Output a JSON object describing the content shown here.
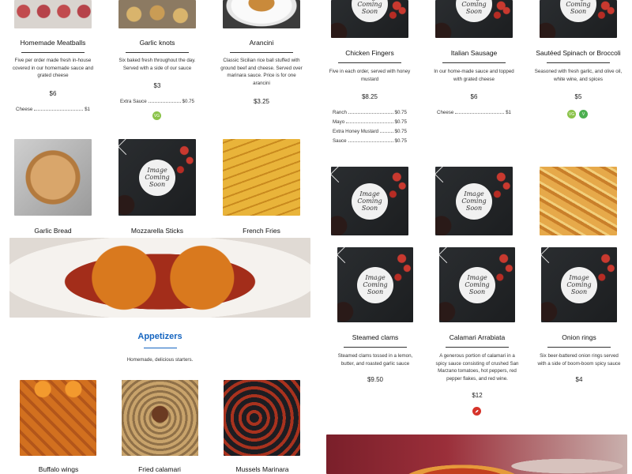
{
  "items": {
    "meatballs": {
      "title": "Homemade Meatballs",
      "desc": "Five per order made fresh in-house covered in our homemade sauce and grated cheese",
      "price": "$6",
      "addons": [
        {
          "name": "Cheese",
          "price": "$1"
        }
      ]
    },
    "garlic_knots": {
      "title": "Garlic knots",
      "desc": "Six baked fresh throughout the day. Served with a side of our sauce",
      "price": "$3",
      "addons": [
        {
          "name": "Extra Sauce",
          "price": "$0.75"
        }
      ],
      "badge": "VG"
    },
    "arancini": {
      "title": "Arancini",
      "desc": "Classic Sicilian rice ball stuffed with ground beef and cheese. Served over marinara sauce. Price is for one arancini",
      "price": "$3.25"
    },
    "chicken_fingers": {
      "title": "Chicken Fingers",
      "desc": "Five in each order, served with honey mustard",
      "price": "$8.25",
      "addons": [
        {
          "name": "Ranch",
          "price": "$0.75"
        },
        {
          "name": "Mayo",
          "price": "$0.75"
        },
        {
          "name": "Extra Honey Mustard",
          "price": "$0.75"
        },
        {
          "name": "Sauce",
          "price": "$0.75"
        }
      ]
    },
    "italian_sausage": {
      "title": "Italian Sausage",
      "desc": "In our home-made sauce and topped with grated cheese",
      "price": "$6",
      "addons": [
        {
          "name": "Cheese",
          "price": "$1"
        }
      ]
    },
    "spinach": {
      "title": "Sautéed Spinach or Broccoli",
      "desc": "Seasoned with fresh garlic, and olive oil, white wine, and spices",
      "price": "$5",
      "badges": [
        "VG",
        "V"
      ]
    },
    "garlic_bread": {
      "title": "Garlic Bread"
    },
    "mozzarella": {
      "title": "Mozzarella Sticks"
    },
    "fries": {
      "title": "French Fries"
    },
    "steamed_clams": {
      "title": "Steamed clams",
      "desc": "Steamed clams tossed in a lemon, butter, and roasted garlic sauce",
      "price": "$9.50"
    },
    "calamari_arrabiata": {
      "title": "Calamari Arrabiata",
      "desc": "A generous portion of calamari in a spicy sauce consisting of crushed San Marzano tomatoes, hot peppers, red pepper flakes, and red wine.",
      "price": "$12"
    },
    "onion_rings": {
      "title": "Onion rings",
      "desc": "Six beer-battered onion rings served with a side of boom-boom spicy sauce",
      "price": "$4"
    },
    "buffalo_wings": {
      "title": "Buffalo wings"
    },
    "fried_calamari": {
      "title": "Fried calamari"
    },
    "mussels": {
      "title": "Mussels Marinara"
    }
  },
  "section": {
    "title": "Appetizers",
    "subtitle": "Homemade, delicious starters."
  },
  "placeholder_text": "Image Coming Soon",
  "colors": {
    "accent": "#1565c0",
    "vegan": "#8bc34a",
    "spicy": "#d6332a"
  }
}
